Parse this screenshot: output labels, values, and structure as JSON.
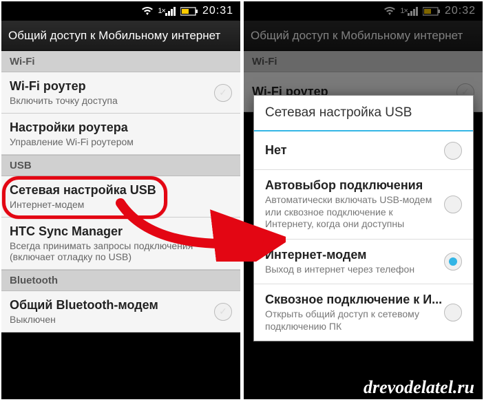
{
  "left": {
    "time": "20:31",
    "header": "Общий доступ к Мобильному интернет",
    "sections": [
      {
        "label": "Wi-Fi"
      },
      {
        "label": "USB"
      },
      {
        "label": "Bluetooth"
      }
    ],
    "items": {
      "wifi_router": {
        "title": "Wi-Fi роутер",
        "sub": "Включить точку доступа"
      },
      "router_settings": {
        "title": "Настройки роутера",
        "sub": "Управление Wi-Fi роутером"
      },
      "usb_net": {
        "title": "Сетевая настройка USB",
        "sub": "Интернет-модем"
      },
      "htc_sync": {
        "title": "HTC Sync Manager",
        "sub": "Всегда принимать запросы подключения (включает отладку по USB)"
      },
      "bt_modem": {
        "title": "Общий Bluetooth-модем",
        "sub": "Выключен"
      }
    }
  },
  "right": {
    "time": "20:32",
    "header": "Общий доступ к Мобильному интернет",
    "bg_item": {
      "title": "Wi-Fi роутер"
    },
    "dialog": {
      "title": "Сетевая настройка USB",
      "options": [
        {
          "title": "Нет",
          "sub": ""
        },
        {
          "title": "Автовыбор подключения",
          "sub": "Автоматически включать USB-модем или сквозное подключение к Интернету, когда они доступны"
        },
        {
          "title": "Интернет-модем",
          "sub": "Выход в интернет через телефон"
        },
        {
          "title": "Сквозное подключение к И...",
          "sub": "Открыть общий доступ к сетевому подключению ПК"
        }
      ],
      "selected_index": 2
    }
  },
  "watermark": "drevodelatel.ru"
}
